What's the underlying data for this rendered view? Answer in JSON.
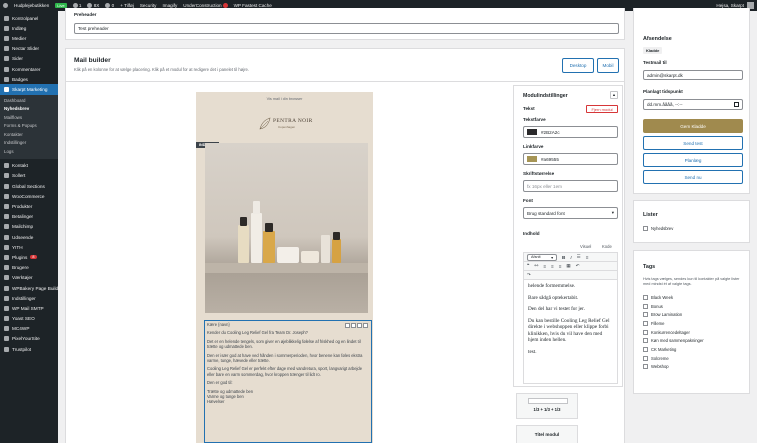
{
  "adminbar": {
    "site": "Hudplejebutikken",
    "live": "Live",
    "counts": [
      "1",
      "8X",
      "0"
    ],
    "new": "Tilføj",
    "items": [
      "Security",
      "Imagify",
      "UnderConstruction",
      "WP Fastest Cache"
    ],
    "howdy": "Hejsa, Skarpt"
  },
  "sidebar": {
    "items": [
      {
        "label": "Kontrolpanel",
        "icon": "dashboard-icon"
      },
      {
        "label": "Indlæg",
        "icon": "pin-icon"
      },
      {
        "label": "Medier",
        "icon": "media-icon"
      },
      {
        "label": "Nectar Slider",
        "icon": "slider-icon"
      },
      {
        "label": "Sider",
        "icon": "page-icon"
      },
      {
        "label": "Kommentarer",
        "icon": "comment-icon"
      },
      {
        "label": "Badges",
        "icon": "badge-icon"
      },
      {
        "label": "Skarpt Marketing",
        "icon": "marketing-icon",
        "active": true
      }
    ],
    "submenu": [
      "Dashboard",
      "Nyhedsbrev",
      "Mailflows",
      "Forms & Popups",
      "Kontakter",
      "Indstillinger",
      "Logs"
    ],
    "items2": [
      {
        "label": "Kontakt",
        "icon": "mail-icon"
      },
      {
        "label": "Sollert",
        "icon": "sollert-icon"
      },
      {
        "label": "Global Sections",
        "icon": "sections-icon"
      },
      {
        "label": "WooCommerce",
        "icon": "woo-icon"
      },
      {
        "label": "Produkter",
        "icon": "products-icon"
      },
      {
        "label": "Betalinger",
        "icon": "payments-icon"
      },
      {
        "label": "Mailchimp",
        "icon": "mailchimp-icon"
      },
      {
        "label": "Udseende",
        "icon": "appearance-icon"
      },
      {
        "label": "YITH",
        "icon": "yith-icon"
      },
      {
        "label": "Plugins",
        "icon": "plugin-icon",
        "badge": "8"
      },
      {
        "label": "Brugere",
        "icon": "users-icon"
      },
      {
        "label": "Værktøjer",
        "icon": "tools-icon"
      },
      {
        "label": "WPBakery Page Builder",
        "icon": "wpbakery-icon"
      },
      {
        "label": "Indstillinger",
        "icon": "settings-icon"
      },
      {
        "label": "WP Mail SMTP",
        "icon": "smtp-icon"
      },
      {
        "label": "Yoast SEO",
        "icon": "yoast-icon"
      },
      {
        "label": "MC4WP",
        "icon": "mc4wp-icon"
      },
      {
        "label": "PixelYourSite",
        "icon": "pixel-icon"
      },
      {
        "label": "Trustpilot",
        "icon": "trustpilot-icon"
      }
    ]
  },
  "preheader": {
    "label": "Preheader",
    "value": "Test preheader"
  },
  "builder": {
    "title": "Mail builder",
    "subtitle": "Klik på en kolonne for at vælge placering. Klik på et modul for at redigere det i panelet til højre.",
    "desktop": "Desktop",
    "mobile": "Mobil"
  },
  "preview": {
    "top_link": "Vis mail i din browser",
    "brand": "PENTRA NOIR",
    "brand_sub": "Copenhagen",
    "tag": "INDHOLD",
    "text_lines": [
      "Kære {navn}",
      "Kender du Cooling Leg Relief Gel fra Team Dr. Joseph?",
      "Det er en helende tengels, som giver en øjeblikkelig følelse af friskhed og en lindet til trætte og udmattede ben.",
      "Den er især god at have ved hånden i sommerperioden, hvor benene kan føles ekstra varme, tunge, hævede eller trætte.",
      "Cooling Leg Relief Gel er perfekt efter dage med vandretura, sport, langvarigt arbejde eller bare en varm sommerdag, hvor kroppen trænger til lidt ro.",
      "Den er god til:",
      "Trætte og udmattede ben",
      "Varme og tunge ben",
      "Hævelser"
    ]
  },
  "module_settings": {
    "title": "Modulindstillinger",
    "text_label": "Tekst",
    "remove": "Fjern modul",
    "text_color_label": "Tekstfarve",
    "text_color": "#2B2A2c",
    "link_color_label": "Linkfarve",
    "link_color": "#a69555",
    "link_swatch": "#a69555",
    "text_swatch": "#2b2a2c",
    "font_size_label": "Skriftstørrelse",
    "font_size_placeholder": "fx 16px eller 1em",
    "font_label": "Font",
    "font_value": "Brug standard font",
    "content_label": "Indhold",
    "tab_visual": "Visuel",
    "tab_code": "Kode",
    "format_value": "Afsnit",
    "editor_paragraphs": [
      "helende formemmelse.",
      "Bare sådgå optekertabit.",
      "Den del har vi testet for jer.",
      "Du kan bestille Cooling Leg Relief Gel direkte i webshoppen eller klippe forbi klinikken, hvis du vil have den med hjem inden hellen.",
      "test."
    ],
    "layout_label": "1/3 + 1/3 + 1/3",
    "title_module": "Titel modul"
  },
  "send": {
    "title": "Afsendelse",
    "status": "Kladde",
    "test_label": "Testmail til",
    "test_value": "admin@skarpt.dk",
    "schedule_label": "Planlagt tidspunkt",
    "schedule_value": "dd.mm.åååå, --:--",
    "save": "Gem Kladde",
    "send_test": "Send test",
    "plan": "Planlæg",
    "send_now": "Send nu"
  },
  "lists": {
    "title": "Lister",
    "items": [
      "Nyhedsbrev"
    ]
  },
  "tags": {
    "title": "Tags",
    "desc": "Hvis tags vælges, sendes kun til kontakter på valgte lister med mindst ét af valgte tags.",
    "items": [
      "Black Week",
      "Bonus",
      "Brow Lamination",
      "Filleme",
      "Konkurrencedeltager",
      "Køn med sammenpakninger",
      "CK Marketing",
      "Solcreme",
      "Webshop"
    ]
  },
  "colors": {
    "accent": "#2271b1",
    "gold": "#a08a4e",
    "admin": "#1d2327",
    "danger": "#d63638"
  }
}
